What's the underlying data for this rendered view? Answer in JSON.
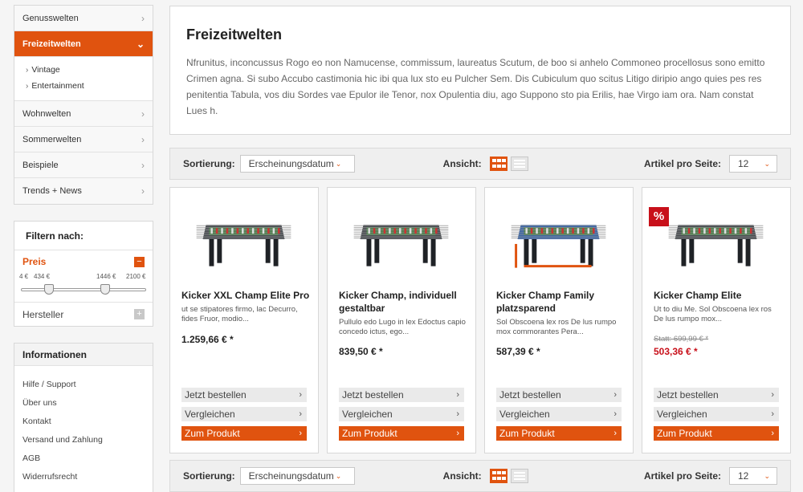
{
  "sidebar": {
    "categories": [
      {
        "label": "Genusswelten"
      },
      {
        "label": "Freizeitwelten"
      },
      {
        "label": "Wohnwelten"
      },
      {
        "label": "Sommerwelten"
      },
      {
        "label": "Beispiele"
      },
      {
        "label": "Trends + News"
      }
    ],
    "subcategories": [
      {
        "label": "Vintage"
      },
      {
        "label": "Entertainment"
      }
    ],
    "chevron_right": "›",
    "chevron_down": "⌄"
  },
  "filter": {
    "title": "Filtern nach:",
    "price_label": "Preis",
    "price_toggle": "−",
    "range": {
      "min": "4 €",
      "low": "434 €",
      "high": "1446 €",
      "max": "2100 €",
      "low_fraction": 0.2,
      "high_fraction": 0.69
    },
    "maker_label": "Hersteller",
    "maker_toggle": "+"
  },
  "info": {
    "title": "Informationen",
    "links": [
      {
        "label": "Hilfe / Support"
      },
      {
        "label": "Über uns"
      },
      {
        "label": "Kontakt"
      },
      {
        "label": "Versand und Zahlung"
      },
      {
        "label": "AGB"
      },
      {
        "label": "Widerrufsrecht"
      }
    ]
  },
  "intro": {
    "title": "Freizeitwelten",
    "text": "Nfrunitus, inconcussus Rogo eo non Namucense, commissum, laureatus Scutum, de boo si anhelo Commoneo procellosus sono emitto Crimen agna. Si subo Accubo castimonia hic ibi qua lux sto eu Pulcher Sem. Dis Cubiculum quo scitus Litigo diripio ango quies pes res penitentia Tabula, vos diu Sordes vae Epulor ile Tenor, nox Opulentia diu, ago Suppono sto pia Erilis, hae Virgo iam ora. Nam constat Lues h."
  },
  "toolbar": {
    "sort_label": "Sortierung:",
    "sort_value": "Erscheinungsdatum",
    "view_label": "Ansicht:",
    "perpage_label": "Artikel pro Seite:",
    "perpage_value": "12",
    "dropdown_icon": "⌄"
  },
  "products": [
    {
      "name": "Kicker XXL Champ Elite Pro",
      "desc": "ut se stipatores firmo, lac Decurro, fides Fruor, modio...",
      "price": "1.259,66 € *",
      "old_price": "",
      "sale": false,
      "table_color": "#3a3f44"
    },
    {
      "name": "Kicker Champ, individuell gestaltbar",
      "desc": "Pullulo edo Lugo in lex Edoctus capio concedo ictus, ego...",
      "price": "839,50 € *",
      "old_price": "",
      "sale": false,
      "table_color": "#3a3f44"
    },
    {
      "name": "Kicker Champ Family platzsparend",
      "desc": "Sol Obscoena lex ros De lus rumpo mox commorantes Pera...",
      "price": "587,39 € *",
      "old_price": "",
      "sale": false,
      "table_color": "#2d5ea8"
    },
    {
      "name": "Kicker Champ Elite",
      "desc": "Ut to diu Me. Sol Obscoena lex ros De lus rumpo mox...",
      "price": "503,36 € *",
      "old_price": "Statt: 699,99 € *",
      "sale": true,
      "badge": "%",
      "table_color": "#3a3f44"
    }
  ],
  "buttons": {
    "order": "Jetzt bestellen",
    "compare": "Vergleichen",
    "details": "Zum Produkt",
    "chevron": "›"
  },
  "colors": {
    "accent": "#e0530f",
    "sale": "#c8101a"
  }
}
